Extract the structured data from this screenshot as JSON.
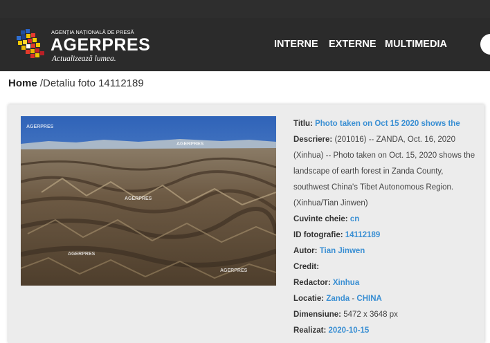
{
  "header": {
    "agency_name": "AGENȚIA NAȚIONALĂ DE PRESĂ",
    "brand": "AGERPRES",
    "slogan": "Actualizează lumea.",
    "nav": [
      "INTERNE",
      "EXTERNE",
      "MULTIMEDIA"
    ]
  },
  "breadcrumb": {
    "home": "Home",
    "separator": " /",
    "current": "Detaliu foto 14112189"
  },
  "photo": {
    "watermark": "AGERPRES"
  },
  "details": {
    "title_label": "Titlu:",
    "title_value": "Photo taken on Oct 15 2020 shows the",
    "description_label": "Descriere:",
    "description_value": "(201016) -- ZANDA, Oct. 16, 2020 (Xinhua) -- Photo taken on Oct. 15, 2020 shows the landscape of earth forest in Zanda County, southwest China's Tibet Autonomous Region. (Xinhua/Tian Jinwen)",
    "keywords_label": "Cuvinte cheie:",
    "keywords_value": "cn",
    "photo_id_label": "ID fotografie:",
    "photo_id_value": "14112189",
    "author_label": "Autor:",
    "author_value": "Tian Jinwen",
    "credit_label": "Credit:",
    "editor_label": "Redactor:",
    "editor_value": "Xinhua",
    "location_label": "Locatie:",
    "location_city": "Zanda",
    "location_sep": "-",
    "location_country": "CHINA",
    "dimensions_label": "Dimensiune:",
    "dimensions_value": "5472 x 3648 px",
    "date_label": "Realizat:",
    "date_value": "2020-10-15"
  },
  "colors": {
    "header_bg": "#2b2b2b",
    "link": "#3a8fd3",
    "card_bg": "#ececec"
  }
}
